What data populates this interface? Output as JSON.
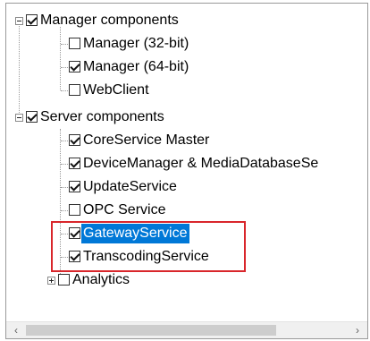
{
  "tree": {
    "groups": [
      {
        "label": "Manager components",
        "checked": true,
        "items": [
          {
            "label": "Manager (32-bit)",
            "checked": false
          },
          {
            "label": "Manager (64-bit)",
            "checked": true
          },
          {
            "label": "WebClient",
            "checked": false
          }
        ]
      },
      {
        "label": "Server components",
        "checked": true,
        "items": [
          {
            "label": "CoreService Master",
            "checked": true
          },
          {
            "label": "DeviceManager & MediaDatabaseSe",
            "checked": true
          },
          {
            "label": "UpdateService",
            "checked": true
          },
          {
            "label": "OPC Service",
            "checked": false
          },
          {
            "label": "GatewayService",
            "checked": true,
            "selected": true
          },
          {
            "label": "TranscodingService",
            "checked": true
          },
          {
            "label": "Analytics",
            "checked": false,
            "expandable": true
          }
        ]
      }
    ]
  },
  "scrollbar": {
    "left_arrow": "‹",
    "right_arrow": "›"
  },
  "colors": {
    "selection": "#0078d7",
    "highlight_border": "#d9262b"
  }
}
